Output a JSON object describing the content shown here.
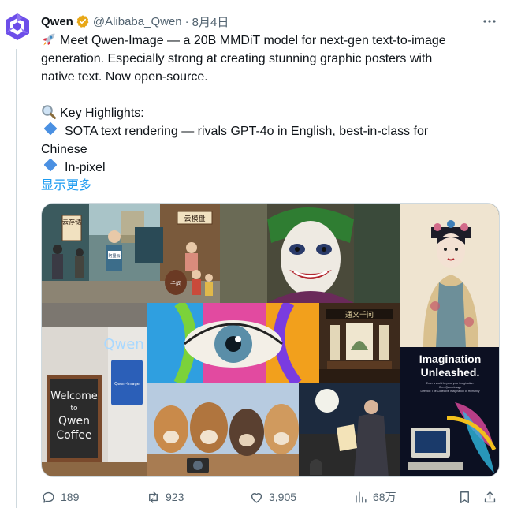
{
  "tweet": {
    "author_name": "Qwen",
    "handle": "@Alibaba_Qwen",
    "separator": "·",
    "date": "8月4日",
    "lines": [
      "Meet Qwen-Image — a 20B MMDiT model for next-gen text-to-image",
      "generation. Especially strong at creating stunning graphic posters with",
      "native text. Now open-source."
    ],
    "highlights_title": "Key Highlights:",
    "bullet1_line1": "SOTA text rendering — rivals GPT-4o in English, best-in-class for",
    "bullet1_line2": "Chinese",
    "bullet2": "In-pixel",
    "show_more": "显示更多"
  },
  "media": {
    "sign_left": "云存储",
    "sign_right": "云模盘",
    "sign_mid": "阿里云",
    "jar_text": "千问",
    "neon": "Qwen",
    "board_lines": [
      "Welcome",
      "to",
      "Qwen",
      "Coffee"
    ],
    "phone_text": "Qwen-Image",
    "plaque": "通义千问",
    "poster_title_1": "Imagination",
    "poster_title_2": "Unleashed.",
    "poster_sub_1": "Enter a world beyond your imagination.",
    "poster_sub_2": "Gen: Qwen-Image",
    "poster_sub_3": "Director: The Collective Imagination of Humanity"
  },
  "actions": {
    "replies": "189",
    "retweets": "923",
    "likes": "3,905",
    "views": "68万"
  },
  "colors": {
    "text": "#0f1419",
    "secondary": "#536471",
    "link": "#1d9bf0",
    "verified": "#e8a818",
    "avatar": "#6d4ee9"
  },
  "icons": [
    "qwen-logo-icon",
    "verified-badge-icon",
    "more-icon",
    "rocket-icon",
    "magnifier-icon",
    "diamond-icon",
    "reply-icon",
    "retweet-icon",
    "like-icon",
    "views-icon",
    "bookmark-icon",
    "share-icon"
  ]
}
